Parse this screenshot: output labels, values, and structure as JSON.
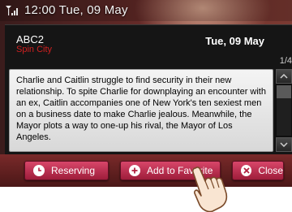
{
  "status_bar": {
    "icon": "signal-icon",
    "text": "12:00 Tue, 09 May"
  },
  "program_panel": {
    "channel": "ABC2",
    "program": "Spin City",
    "date": "Tue, 09 May",
    "page_indicator": "1/4",
    "description": "Charlie and Caitlin struggle to find security in their new relationship. To spite Charlie for downplaying an encounter with an ex, Caitlin accompanies one of New York's ten sexiest men on a business date to make Charlie jealous. Meanwhile, the Mayor plots a way to one-up his rival, the Mayor of Los Angeles."
  },
  "scrollbar": {
    "up_icon": "chevron-up-icon",
    "down_icon": "chevron-down-icon"
  },
  "buttons": {
    "reserving": {
      "label": "Reserving",
      "icon": "clock-icon"
    },
    "add_favorite": {
      "label": "Add to Favorite",
      "icon": "plus-icon"
    },
    "close": {
      "label": "Close",
      "icon": "close-icon"
    }
  },
  "colors": {
    "button_pink": "#c6305a",
    "program_name_red": "#d02020",
    "panel_dark": "#151515"
  },
  "cursor_icon": "pointing-hand-icon"
}
